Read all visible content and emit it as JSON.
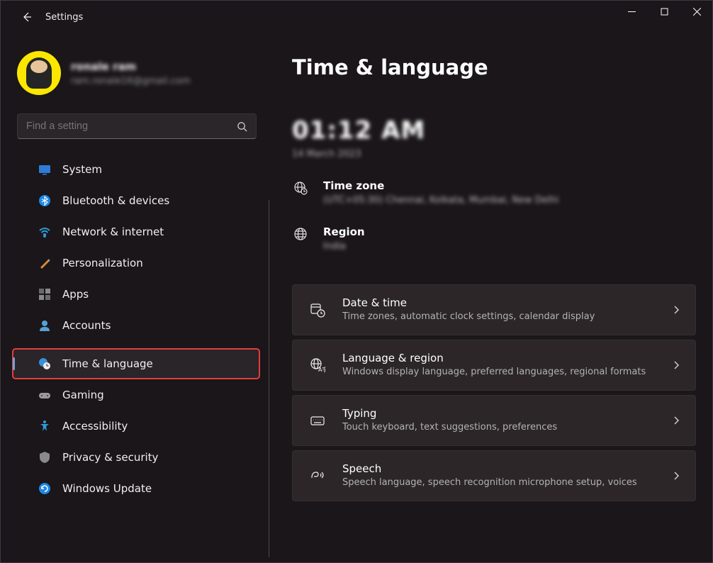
{
  "app": {
    "title": "Settings"
  },
  "profile": {
    "name": "ronale ram",
    "email": "ram.ronale16@gmail.com"
  },
  "search": {
    "placeholder": "Find a setting"
  },
  "nav": {
    "system": "System",
    "bluetooth": "Bluetooth & devices",
    "network": "Network & internet",
    "personalization": "Personalization",
    "apps": "Apps",
    "accounts": "Accounts",
    "timelang": "Time & language",
    "gaming": "Gaming",
    "accessibility": "Accessibility",
    "privacy": "Privacy & security",
    "update": "Windows Update"
  },
  "page": {
    "title": "Time & language",
    "clock": "01:12 AM",
    "date": "14 March 2023",
    "timezone": {
      "label": "Time zone",
      "value": "(UTC+05:30) Chennai, Kolkata, Mumbai, New Delhi"
    },
    "region": {
      "label": "Region",
      "value": "India"
    }
  },
  "cards": {
    "date_time": {
      "title": "Date & time",
      "sub": "Time zones, automatic clock settings, calendar display"
    },
    "lang_region": {
      "title": "Language & region",
      "sub": "Windows display language, preferred languages, regional formats"
    },
    "typing": {
      "title": "Typing",
      "sub": "Touch keyboard, text suggestions, preferences"
    },
    "speech": {
      "title": "Speech",
      "sub": "Speech language, speech recognition microphone setup, voices"
    }
  }
}
